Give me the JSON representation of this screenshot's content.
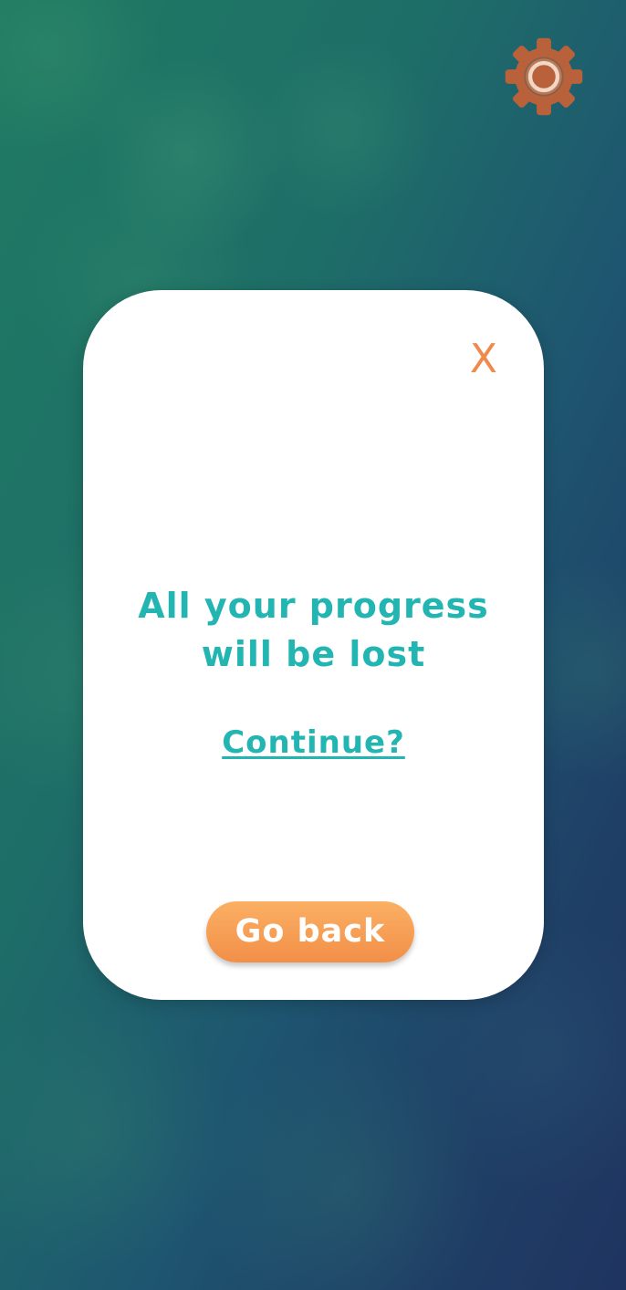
{
  "settings": {
    "icon": "gear-icon",
    "color": "#b8613a"
  },
  "dialog": {
    "close_label": "X",
    "message_line1": "All your progress",
    "message_line2": "will be lost",
    "continue_label": "Continue?",
    "go_back_label": "Go back"
  },
  "colors": {
    "accent_teal": "#22b5b2",
    "accent_orange": "#f08a4b",
    "button_gradient_top": "#fbb064",
    "button_gradient_bottom": "#f28f48"
  }
}
